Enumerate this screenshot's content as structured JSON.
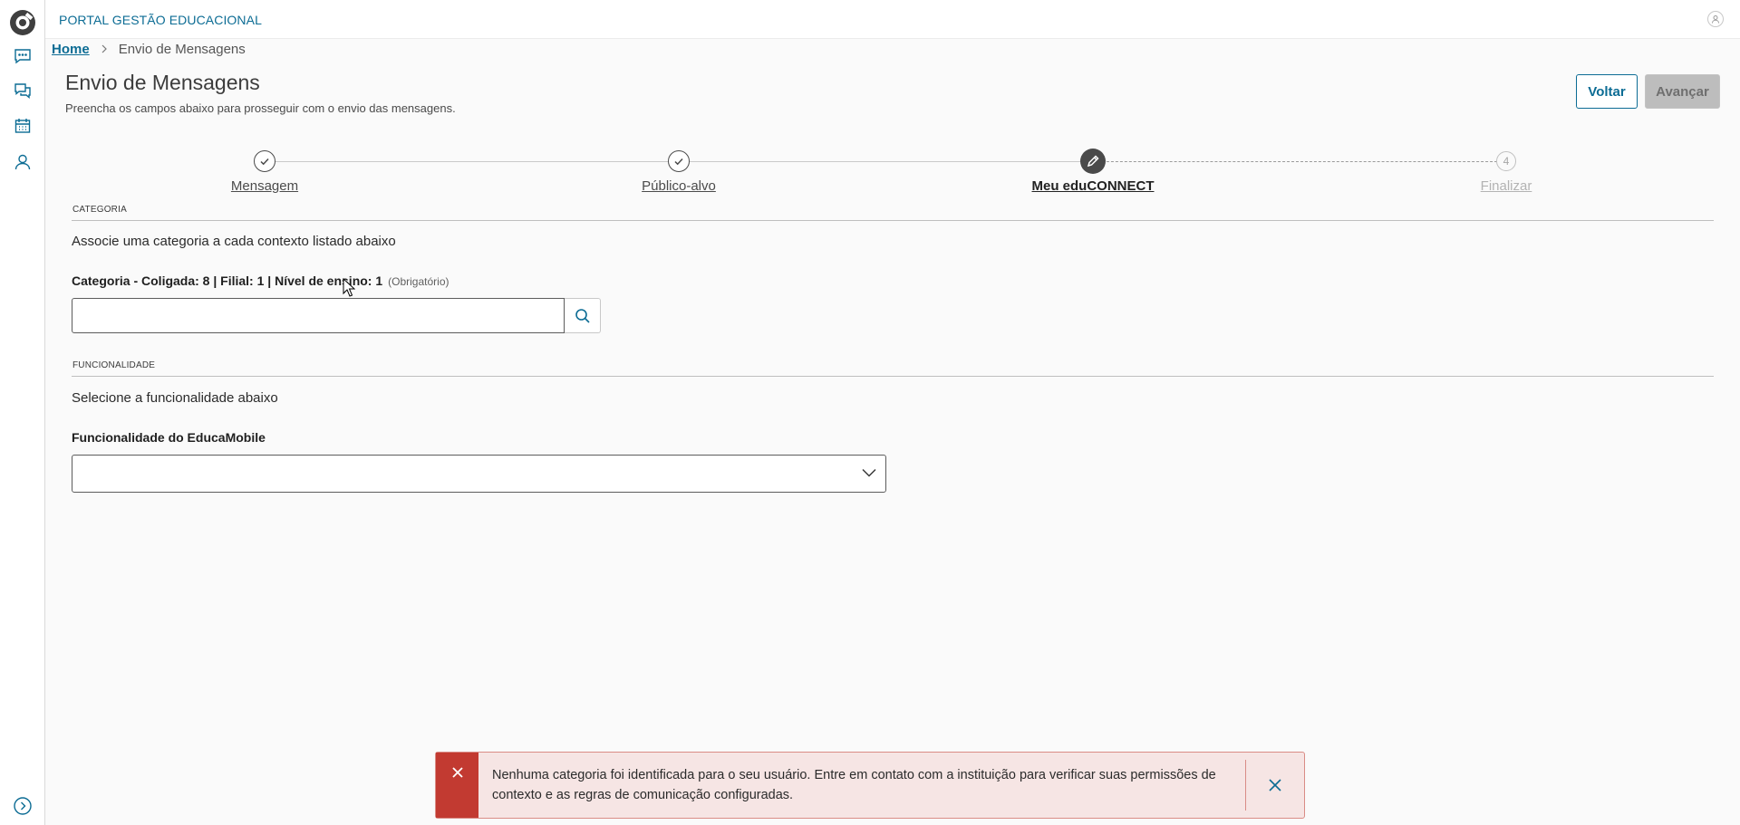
{
  "header": {
    "portal_title": "PORTAL GESTÃO EDUCACIONAL"
  },
  "sidebar": {
    "items": [
      {
        "icon": "message-icon"
      },
      {
        "icon": "chat-icon"
      },
      {
        "icon": "calendar-icon"
      },
      {
        "icon": "user-icon"
      }
    ],
    "expand_icon": "chevron-right-circle-icon"
  },
  "breadcrumb": {
    "home": "Home",
    "current": "Envio de Mensagens"
  },
  "page": {
    "title": "Envio de Mensagens",
    "subtitle": "Preencha os campos abaixo para prosseguir com o envio das mensagens."
  },
  "actions": {
    "back_label": "Voltar",
    "next_label": "Avançar"
  },
  "stepper": {
    "steps": [
      {
        "label": "Mensagem",
        "state": "done"
      },
      {
        "label": "Público-alvo",
        "state": "done"
      },
      {
        "label": "Meu eduCONNECT",
        "state": "active"
      },
      {
        "label": "Finalizar",
        "state": "todo",
        "number": "4"
      }
    ]
  },
  "categoria": {
    "section_title": "CATEGORIA",
    "description": "Associe uma categoria a cada contexto listado abaixo",
    "field_label": "Categoria - Coligada: 8 | Filial: 1 | Nível de ensino: 1",
    "required_label": "(Obrigatório)",
    "value": ""
  },
  "funcionalidade": {
    "section_title": "FUNCIONALIDADE",
    "description": "Selecione a funcionalidade abaixo",
    "field_label": "Funcionalidade do EducaMobile",
    "selected": ""
  },
  "toast": {
    "type": "error",
    "message": "Nenhuma categoria foi identificada para o seu usuário. Entre em contato com a instituição para verificar suas permissões de contexto e as regras de comunicação configuradas."
  },
  "colors": {
    "accent": "#0c6c94",
    "error": "#c23a31",
    "error_bg": "#f6e5e4",
    "step_active": "#4a4a4a"
  }
}
